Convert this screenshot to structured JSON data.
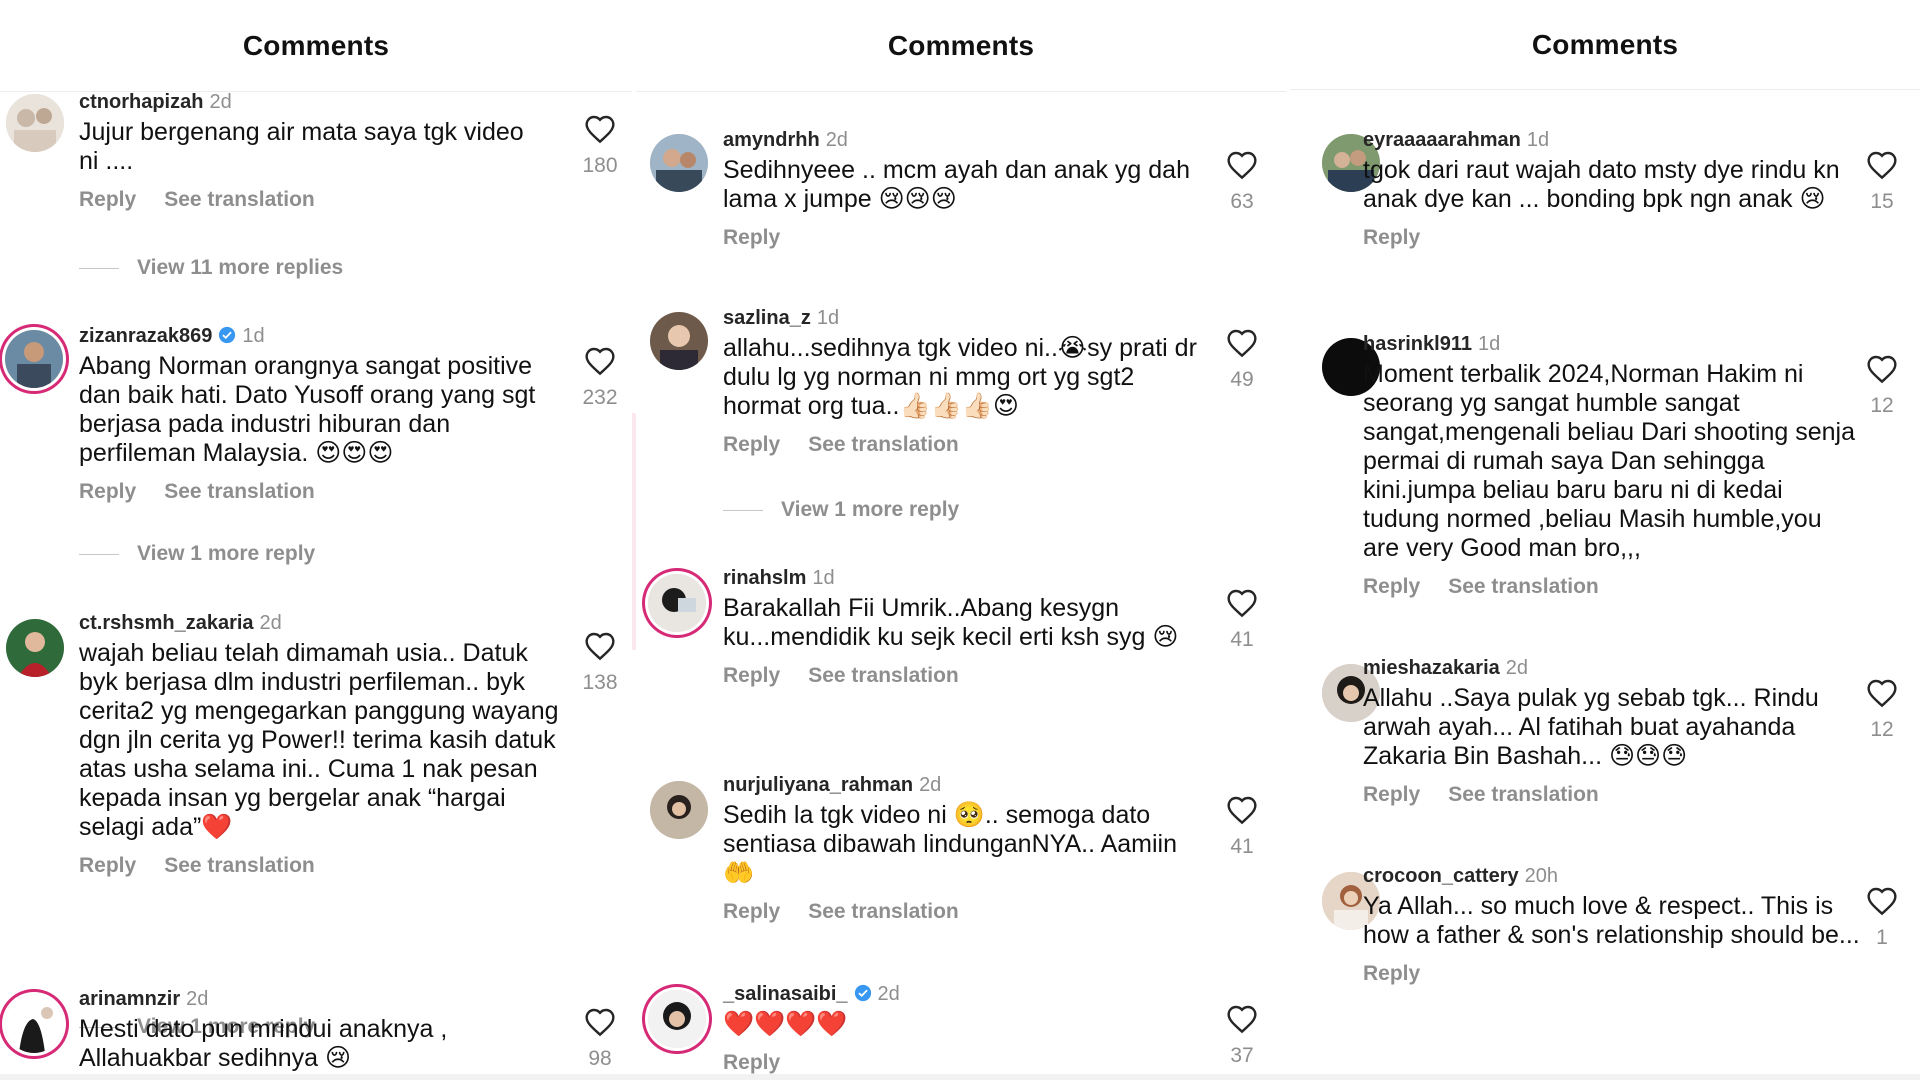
{
  "colors": {
    "ring": "#d62976",
    "verified": "#3897f0",
    "muted": "#8e8e8e",
    "watermark": "#e8749a"
  },
  "icons": {
    "like": "heart-outline-icon",
    "verified": "verified-badge-icon"
  },
  "panels": [
    {
      "header": "Comments",
      "comments": [
        {
          "username": "ctnorhapizah",
          "age": "2d",
          "verified": false,
          "text": "Jujur bergenang air mata saya tgk video ni ....",
          "likes": "180",
          "reply": "Reply",
          "translate": "See translation",
          "more_replies": "View 11 more replies"
        },
        {
          "username": "zizanrazak869",
          "age": "1d",
          "verified": true,
          "text": "Abang Norman orangnya sangat positive dan baik hati. Dato Yusoff orang yang sgt berjasa pada industri hiburan dan perfileman Malaysia. 😍😍😍",
          "likes": "232",
          "reply": "Reply",
          "translate": "See translation",
          "more_replies": "View 1 more reply"
        },
        {
          "username": "ct.rshsmh_zakaria",
          "age": "2d",
          "verified": false,
          "text": "wajah beliau telah dimamah usia.. Datuk byk berjasa dlm industri perfileman.. byk cerita2 yg mengegarkan panggung wayang dgn jln cerita yg Power!! terima kasih datuk atas usha selama ini.. Cuma 1 nak pesan kepada insan yg bergelar anak “hargai selagi ada”❤️",
          "likes": "138",
          "reply": "Reply",
          "translate": "See translation",
          "more_replies": "View 1 more reply"
        },
        {
          "username": "arinamnzir",
          "age": "2d",
          "verified": false,
          "text": "Mesti dato pun mrindui anaknya , Allahuakbar sedihnya 😢",
          "likes": "98",
          "reply": "",
          "translate": "",
          "more_replies": ""
        }
      ]
    },
    {
      "header": "Comments",
      "comments": [
        {
          "username": "amyndrhh",
          "age": "2d",
          "verified": false,
          "text": "Sedihnyeee .. mcm ayah dan anak yg dah lama x jumpe 😢😢😢",
          "likes": "63",
          "reply": "Reply",
          "translate": "",
          "more_replies": ""
        },
        {
          "username": "sazlina_z",
          "age": "1d",
          "verified": false,
          "text": "allahu...sedihnya tgk video ni..😭sy prati dr dulu lg yg norman ni mmg ort yg sgt2 hormat org tua..👍🏻👍🏻👍🏻😍",
          "likes": "49",
          "reply": "Reply",
          "translate": "See translation",
          "more_replies": "View 1 more reply"
        },
        {
          "username": "rinahslm",
          "age": "1d",
          "verified": false,
          "text": "Barakallah Fii Umrik..Abang kesygn ku...mendidik ku sejk kecil erti ksh syg 😢",
          "likes": "41",
          "reply": "Reply",
          "translate": "See translation",
          "more_replies": ""
        },
        {
          "username": "nurjuliyana_rahman",
          "age": "2d",
          "verified": false,
          "text": "Sedih la tgk video ni 🥺.. semoga dato sentiasa dibawah lindunganNYA.. Aamiin 🤲",
          "likes": "41",
          "reply": "Reply",
          "translate": "See translation",
          "more_replies": ""
        },
        {
          "username": "_salinasaibi_",
          "age": "2d",
          "verified": true,
          "text": "❤️❤️❤️❤️",
          "likes": "37",
          "reply": "Reply",
          "translate": "",
          "more_replies": ""
        }
      ]
    },
    {
      "header": "Comments",
      "comments": [
        {
          "username": "eyraaaaarahman",
          "age": "1d",
          "verified": false,
          "text": "tgok dari raut wajah dato msty dye rindu kn anak dye kan ... bonding bpk ngn anak 😢",
          "likes": "15",
          "reply": "Reply",
          "translate": "",
          "more_replies": ""
        },
        {
          "username": "hasrinkl911",
          "age": "1d",
          "verified": false,
          "text": "Moment terbalik 2024,Norman Hakim ni seorang yg sangat humble sangat sangat,mengenali beliau Dari shooting senja permai di rumah saya Dan sehingga kini.jumpa beliau baru baru ni di kedai tudung normed ,beliau Masih humble,you are very Good man bro,,,",
          "likes": "12",
          "reply": "Reply",
          "translate": "See translation",
          "more_replies": ""
        },
        {
          "username": "mieshazakaria",
          "age": "2d",
          "verified": false,
          "text": "Allahu ..Saya pulak yg sebab tgk... Rindu arwah ayah... Al fatihah buat ayahanda Zakaria Bin Bashah... 😓😓😓",
          "likes": "12",
          "reply": "Reply",
          "translate": "See translation",
          "more_replies": ""
        },
        {
          "username": "crocoon_cattery",
          "age": "20h",
          "verified": false,
          "text": "Ya Allah... so much love & respect.. This is how a father & son's relationship should be...",
          "likes": "1",
          "reply": "Reply",
          "translate": "",
          "more_replies": ""
        }
      ]
    }
  ]
}
